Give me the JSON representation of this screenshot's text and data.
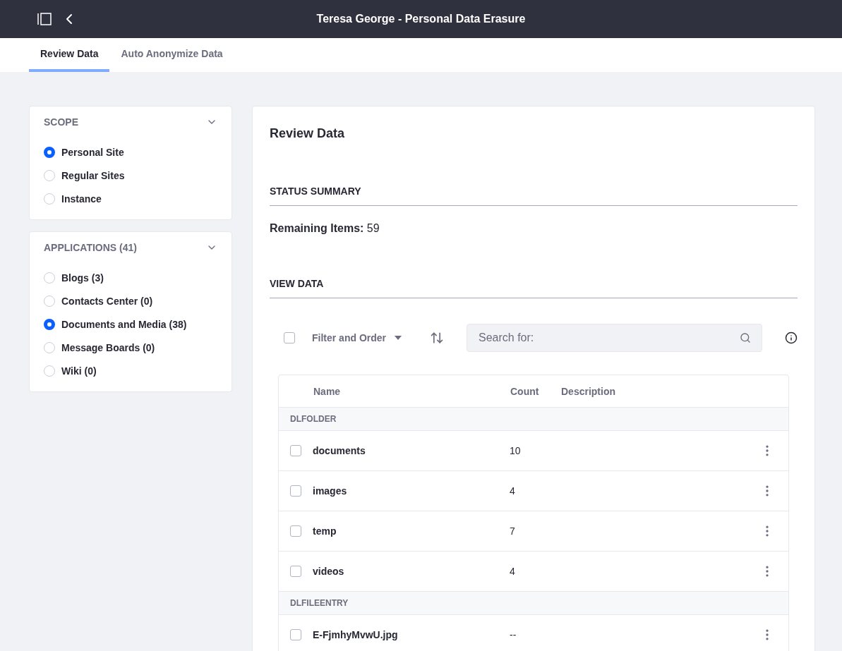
{
  "header": {
    "title": "Teresa George - Personal Data Erasure"
  },
  "tabs": [
    {
      "label": "Review Data",
      "selected": true
    },
    {
      "label": "Auto Anonymize Data",
      "selected": false
    }
  ],
  "filters": [
    {
      "title": "SCOPE",
      "expanded": true,
      "options": [
        {
          "label": "Personal Site",
          "selected": true
        },
        {
          "label": "Regular Sites",
          "selected": false
        },
        {
          "label": "Instance",
          "selected": false
        }
      ]
    },
    {
      "title": "APPLICATIONS (41)",
      "expanded": true,
      "options": [
        {
          "label": "Blogs (3)",
          "selected": false
        },
        {
          "label": "Contacts Center (0)",
          "selected": false
        },
        {
          "label": "Documents and Media (38)",
          "selected": true
        },
        {
          "label": "Message Boards (0)",
          "selected": false
        },
        {
          "label": "Wiki (0)",
          "selected": false
        }
      ]
    }
  ],
  "main": {
    "title": "Review Data",
    "status_heading": "STATUS SUMMARY",
    "remaining": "**Remaining Items:** 59",
    "view_heading": "VIEW DATA"
  },
  "toolbar": {
    "select_all_checked": false,
    "filter_label": "Filter and Order",
    "search": {
      "placeholder": "Search for:"
    }
  },
  "table": {
    "columns": [
      "Name",
      "Count",
      "Description"
    ],
    "rows": [
      {
        "kind": "group",
        "label": "DLFOLDER"
      },
      {
        "kind": "item",
        "name": "documents",
        "count": "10",
        "checked": false
      },
      {
        "kind": "item",
        "name": "images",
        "count": "4",
        "checked": false
      },
      {
        "kind": "item",
        "name": "temp",
        "count": "7",
        "checked": false
      },
      {
        "kind": "item",
        "name": "videos",
        "count": "4",
        "checked": false
      },
      {
        "kind": "group",
        "label": "DLFILEENTRY"
      },
      {
        "kind": "item",
        "name": "E-FjmhyMvwU.jpg",
        "count": "--",
        "checked": false
      }
    ]
  }
}
